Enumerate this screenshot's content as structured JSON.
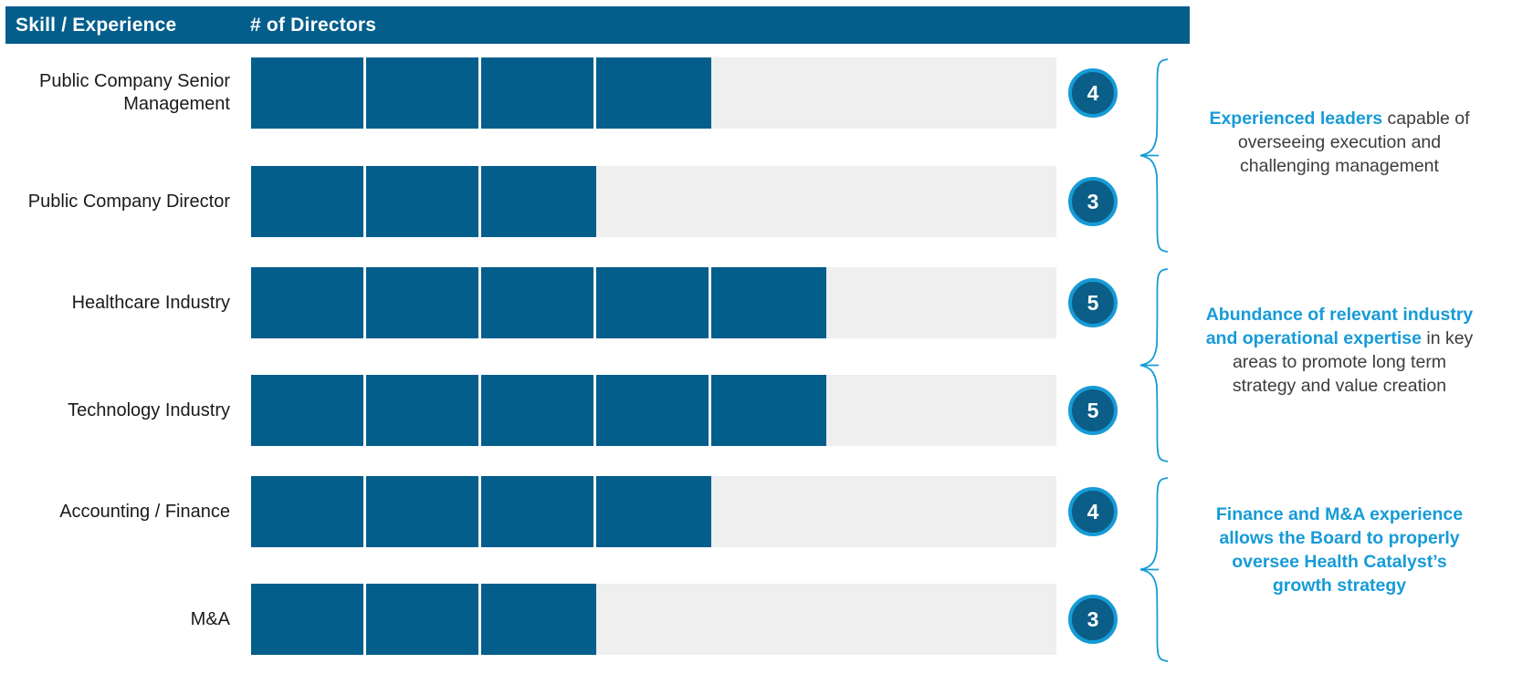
{
  "header": {
    "skill_label": "Skill / Experience",
    "count_label": "# of Directors",
    "bg_color": "#035E8C"
  },
  "theme": {
    "bar_fill": "#035E8C",
    "bar_track": "#EFEFEF",
    "accent": "#169BD7",
    "badge_fill": "#0B5E87",
    "text": "#3c3c3c"
  },
  "chart_data": {
    "type": "bar",
    "title": "Skill / Experience",
    "xlabel": "# of Directors",
    "ylabel": "",
    "xlim": [
      0,
      7
    ],
    "segments_total": 7,
    "grid": false,
    "legend": null,
    "orientation": "horizontal",
    "categories": [
      "Public Company Senior Management",
      "Public Company Director",
      "Healthcare Industry",
      "Technology Industry",
      "Accounting / Finance",
      "M&A"
    ],
    "values": [
      4,
      3,
      5,
      5,
      4,
      3
    ]
  },
  "rows": [
    {
      "label": "Public Company Senior\nManagement",
      "value": 4,
      "value_text": "4"
    },
    {
      "label": "Public Company Director",
      "value": 3,
      "value_text": "3"
    },
    {
      "label": "Healthcare Industry",
      "value": 5,
      "value_text": "5"
    },
    {
      "label": "Technology Industry",
      "value": 5,
      "value_text": "5"
    },
    {
      "label": "Accounting / Finance",
      "value": 4,
      "value_text": "4"
    },
    {
      "label": "M&A",
      "value": 3,
      "value_text": "3"
    }
  ],
  "annotations": [
    {
      "bold_part": "Experienced leaders",
      "rest_part": " capable of overseeing execution and challenging management",
      "all_accent": false
    },
    {
      "bold_part": "Abundance of relevant industry and operational expertise",
      "rest_part": " in key areas to promote long term strategy and value creation",
      "all_accent": false
    },
    {
      "bold_part": "Finance and M&A experience allows the Board to properly oversee Health Catalyst’s growth strategy",
      "rest_part": "",
      "all_accent": true
    }
  ]
}
